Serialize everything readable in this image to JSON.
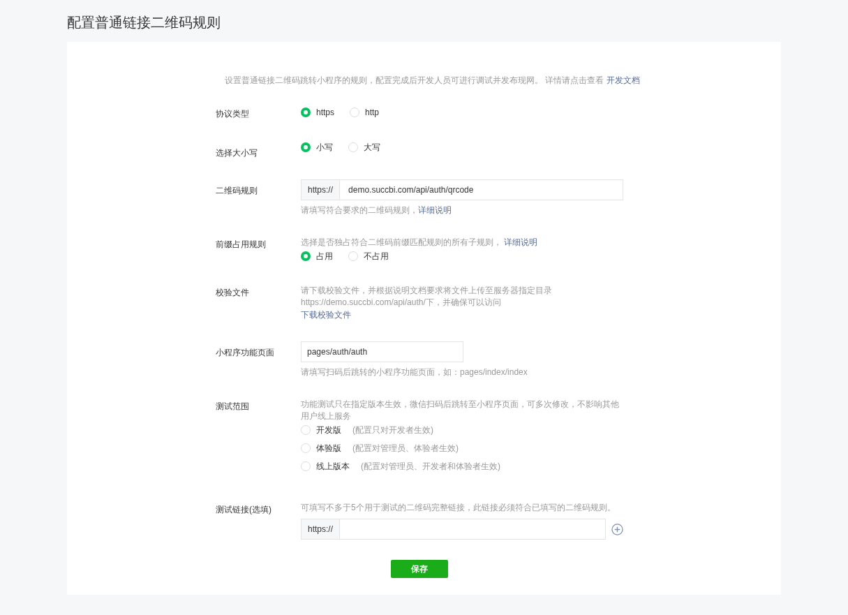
{
  "title": "配置普通链接二维码规则",
  "intro": {
    "text": "设置普通链接二维码跳转小程序的规则，配置完成后开发人员可进行调试并发布现网。 详情请点击查看",
    "link": "开发文档"
  },
  "fields": [
    {
      "kind": "radio",
      "label": "协议类型",
      "options": [
        {
          "label": "https",
          "selected": true
        },
        {
          "label": "http",
          "selected": false
        }
      ]
    },
    {
      "kind": "radio",
      "label": "选择大小写",
      "options": [
        {
          "label": "小写",
          "selected": true
        },
        {
          "label": "大写",
          "selected": false
        }
      ]
    },
    {
      "kind": "prefixed_input",
      "label": "二维码规则",
      "prefix": "https://",
      "value": "demo.succbi.com/api/auth/qrcode",
      "hint": "请填写符合要求的二维码规则，",
      "hint_link": "详细说明"
    },
    {
      "kind": "radio",
      "label": "前缀占用规则",
      "description": "选择是否独占符合二维码前缀匹配规则的所有子规则，",
      "description_link": "详细说明",
      "options": [
        {
          "label": "占用",
          "selected": true
        },
        {
          "label": "不占用",
          "selected": false
        }
      ]
    },
    {
      "kind": "download",
      "label": "校验文件",
      "description": "请下载校验文件，并根据说明文档要求将文件上传至服务器指定目录https://demo.succbi.com/api/auth/下，并确保可以访问",
      "link": "下载校验文件"
    },
    {
      "kind": "input",
      "label": "小程序功能页面",
      "value": "pages/auth/auth",
      "hint": "请填写扫码后跳转的小程序功能页面，如：pages/index/index"
    },
    {
      "kind": "radio_list",
      "label": "测试范围",
      "description": "功能测试只在指定版本生效，微信扫码后跳转至小程序页面，可多次修改，不影响其他用户线上服务",
      "options": [
        {
          "label": "开发版",
          "note": "(配置只对开发者生效)",
          "selected": false
        },
        {
          "label": "体验版",
          "note": "(配置对管理员、体验者生效)",
          "selected": false
        },
        {
          "label": "线上版本",
          "note": "(配置对管理员、开发者和体验者生效)",
          "selected": false
        }
      ]
    },
    {
      "kind": "prefixed_input",
      "label": "测试链接(选填)",
      "description": "可填写不多于5个用于测试的二维码完整链接，此链接必须符合已填写的二维码规则。",
      "prefix": "https://",
      "add": true
    }
  ],
  "save": "保存"
}
